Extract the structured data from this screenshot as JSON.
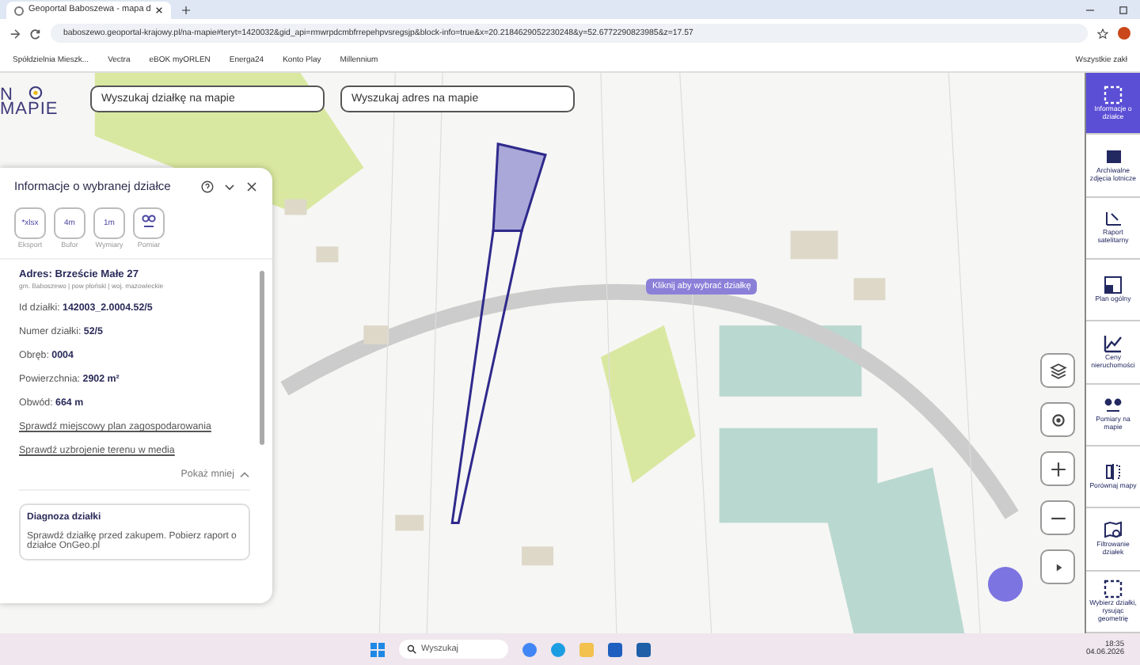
{
  "browser": {
    "tab_title": "Geoportal Baboszewa - mapa d",
    "url": "baboszewo.geoportal-krajowy.pl/na-mapie#teryt=1420032&gid_api=rmwrpdcmbfrrepehpvsregsjp&block-info=true&x=20.2184629052230248&y=52.6772290823985&z=17.57",
    "bookmarks": [
      "Spółdzielnia Mieszk...",
      "Vectra",
      "eBOK myORLEN",
      "Energa24",
      "Konto Play",
      "Millennium"
    ],
    "all_bookmarks": "Wszystkie zakł"
  },
  "logo": {
    "top": "N",
    "bottom": "MAPIE"
  },
  "search": [
    {
      "placeholder": "Wyszukaj działkę na mapie"
    },
    {
      "placeholder": "Wyszukaj adres na mapie"
    }
  ],
  "map": {
    "hint": "Kliknij aby wybrać działkę"
  },
  "panel": {
    "title": "Informacje o wybranej działce",
    "tools": [
      {
        "icon": "*xlsx",
        "label": "Eksport"
      },
      {
        "icon": "4m",
        "label": "Bufor"
      },
      {
        "icon": "1m",
        "label": "Wymiary"
      },
      {
        "label": "Pomiar"
      }
    ],
    "address": "Adres: Brzeście Małe 27",
    "region": "gm. Baboszewo | pow płoński | woj. mazowieckie",
    "fields": [
      {
        "label": "Id działki:",
        "value": "142003_2.0004.52/5"
      },
      {
        "label": "Numer działki:",
        "value": "52/5"
      },
      {
        "label": "Obręb:",
        "value": "0004"
      },
      {
        "label": "Powierzchnia:",
        "value": "2902 m²"
      },
      {
        "label": "Obwód:",
        "value": "664 m"
      }
    ],
    "links": [
      "Sprawdź miejscowy plan zagospodarowania",
      "Sprawdź uzbrojenie terenu w media"
    ],
    "toggle": "Pokaż mniej",
    "card": {
      "title": "Diagnoza działki",
      "text": "Sprawdź działkę przed zakupem. Pobierz raport o działce OnGeo.pl"
    }
  },
  "sidebar": [
    {
      "kind": "info",
      "label": "Informacje o działce",
      "selected": true
    },
    {
      "kind": "photo",
      "label": "Archiwalne zdjęcia lotnicze",
      "selected": false
    },
    {
      "kind": "satellite",
      "label": "Raport satelitarny",
      "selected": false
    },
    {
      "kind": "plan",
      "label": "Plan ogólny",
      "selected": false
    },
    {
      "kind": "chart",
      "label": "Ceny nieruchomości",
      "selected": false
    },
    {
      "kind": "measure",
      "label": "Pomiary na mapie",
      "selected": false
    },
    {
      "kind": "compare",
      "label": "Porównaj mapy",
      "selected": false
    },
    {
      "kind": "filter",
      "label": "Filtrowanie działek",
      "selected": false
    },
    {
      "kind": "info",
      "label": "Wybierz działki, rysując geometrię",
      "selected": false
    }
  ],
  "taskbar": {
    "search": "Wyszukaj",
    "time": "18:35",
    "date": "04.06.2026"
  }
}
